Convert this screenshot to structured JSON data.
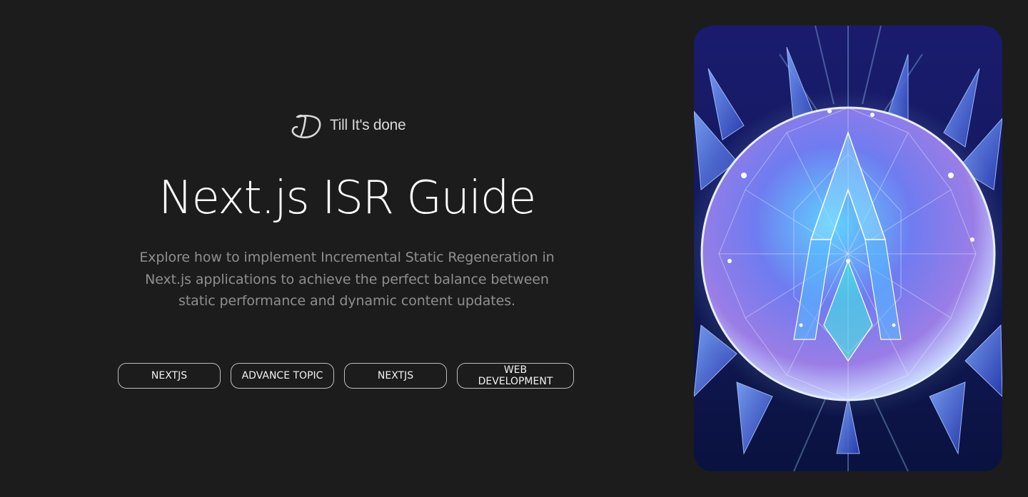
{
  "brand": {
    "name": "Till It's done",
    "logo_icon": "signature-d-logo-icon"
  },
  "hero": {
    "title": "Next.js ISR Guide",
    "description": "Explore how to implement Incremental Static Regeneration in Next.js applications to achieve the perfect balance between static performance and dynamic content updates."
  },
  "tags": [
    {
      "label": "NEXTJS"
    },
    {
      "label": "ADVANCE TOPIC"
    },
    {
      "label": "NEXTJS"
    },
    {
      "label": "WEB DEVELOPMENT"
    }
  ],
  "image": {
    "subject": "crystal-orb-illustration"
  },
  "colors": {
    "background": "#1c1c1c",
    "title": "#ffffff",
    "description": "#8f8f8f",
    "tag_border": "#bdbdbd"
  }
}
